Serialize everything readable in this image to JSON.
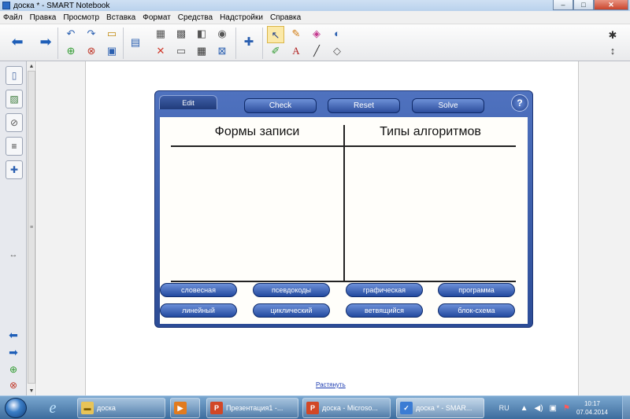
{
  "window": {
    "title": "доска * - SMART Notebook",
    "controls": [
      "–",
      "□",
      "✕"
    ]
  },
  "menu": [
    "Файл",
    "Правка",
    "Просмотр",
    "Вставка",
    "Формат",
    "Средства",
    "Надстройки",
    "Справка"
  ],
  "toolbar": {
    "icons": [
      "back-icon",
      "forward-icon",
      "undo-icon",
      "redo-icon",
      "open-icon",
      "add-page-icon",
      "delete-page-icon",
      "save-icon",
      "screen-shade-icon",
      "paste-icon",
      "delete-icon",
      "screen-capture-icon",
      "show-hide-icon",
      "table-icon",
      "close-window-icon",
      "document-camera-icon",
      "insert-icon",
      "select-icon",
      "pen-icon",
      "eraser-icon",
      "fill-icon",
      "creative-pen-icon",
      "text-icon",
      "line-icon",
      "magic-pen-icon",
      "settings-icon",
      "move-toolbar-icon"
    ],
    "active_tool": "select-icon"
  },
  "side_tabs": [
    "page-sorter-icon",
    "gallery-icon",
    "attachments-icon",
    "properties-icon",
    "addons-icon"
  ],
  "side_bottom_icons": [
    "back-arrow-icon",
    "forward-arrow-icon",
    "add-page-icon",
    "delete-page-icon"
  ],
  "widget": {
    "edit_label": "Edit",
    "check_label": "Check",
    "reset_label": "Reset",
    "solve_label": "Solve",
    "help_label": "?",
    "col1_heading": "Формы записи",
    "col2_heading": "Типы алгоритмов",
    "chips_row1": [
      "словесная",
      "псевдокоды",
      "графическая",
      "программа"
    ],
    "chips_row2": [
      "линейный",
      "циклический",
      "ветвящийся",
      "блок-схема"
    ]
  },
  "stretch_link": "Растянуть",
  "taskbar": {
    "tasks": [
      {
        "label": "доска",
        "icon": "folder-icon"
      },
      {
        "label": "",
        "icon": "media-player-icon"
      },
      {
        "label": "Презентация1 -...",
        "icon": "powerpoint-icon"
      },
      {
        "label": "доска - Microso...",
        "icon": "powerpoint-icon"
      },
      {
        "label": "доска * - SMAR...",
        "icon": "smart-notebook-icon"
      }
    ],
    "lang": "RU",
    "time": "10:17",
    "date": "07.04.2014"
  }
}
